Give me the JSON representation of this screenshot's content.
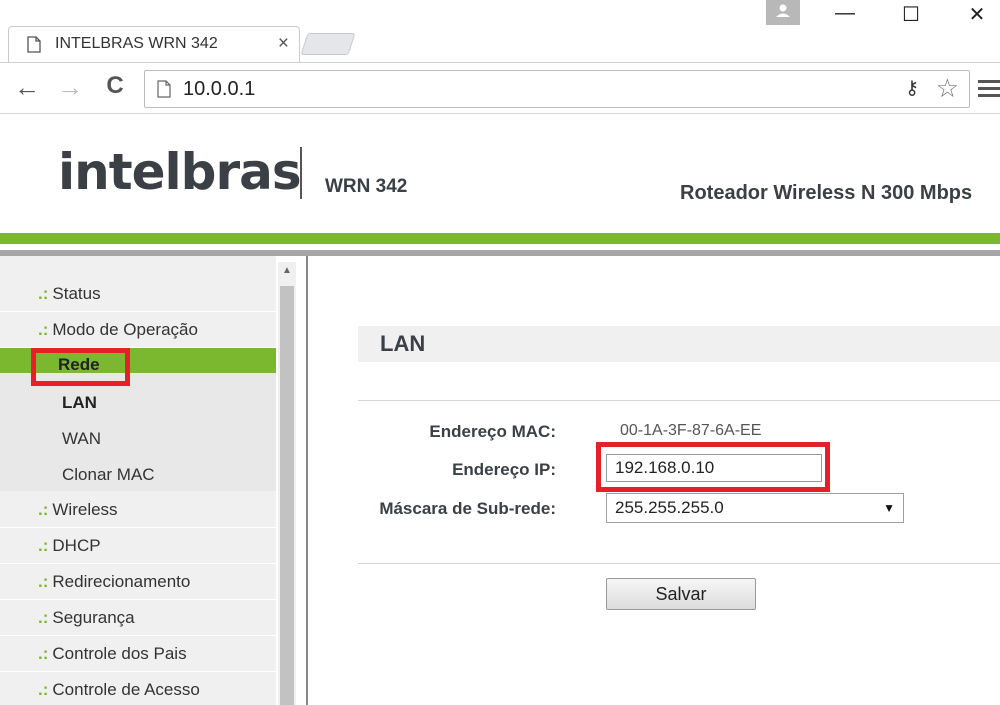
{
  "browser": {
    "tab_title": "INTELBRAS WRN 342",
    "tab_close": "×",
    "url": "10.0.0.1",
    "win_minimize": "—",
    "win_maximize": "☐",
    "win_close": "✕",
    "back": "←",
    "forward": "→",
    "reload": "C",
    "key_glyph": "⚷",
    "star_glyph": "☆"
  },
  "router": {
    "logo": "intelbras",
    "model": "WRN 342",
    "tagline": "Roteador Wireless N 300 Mbps"
  },
  "sidebar": {
    "bullet": ".:",
    "items": [
      {
        "label": "Status"
      },
      {
        "label": "Modo de Operação"
      },
      {
        "label": "Rede"
      },
      {
        "label": "Wireless"
      },
      {
        "label": "DHCP"
      },
      {
        "label": "Redirecionamento"
      },
      {
        "label": "Segurança"
      },
      {
        "label": "Controle dos Pais"
      },
      {
        "label": "Controle de Acesso"
      }
    ],
    "subitems": [
      {
        "label": "LAN"
      },
      {
        "label": "WAN"
      },
      {
        "label": "Clonar MAC"
      }
    ],
    "scroll_up": "▲"
  },
  "content": {
    "section_title": "LAN",
    "mac_label": "Endereço MAC:",
    "mac_value": "00-1A-3F-87-6A-EE",
    "ip_label": "Endereço IP:",
    "ip_value": "192.168.0.10",
    "mask_label": "Máscara de Sub-rede:",
    "mask_value": "255.255.255.0",
    "mask_arrow": "▼",
    "save_label": "Salvar"
  },
  "colors": {
    "accent_green": "#7cb82f",
    "highlight_red": "#e4202a"
  }
}
